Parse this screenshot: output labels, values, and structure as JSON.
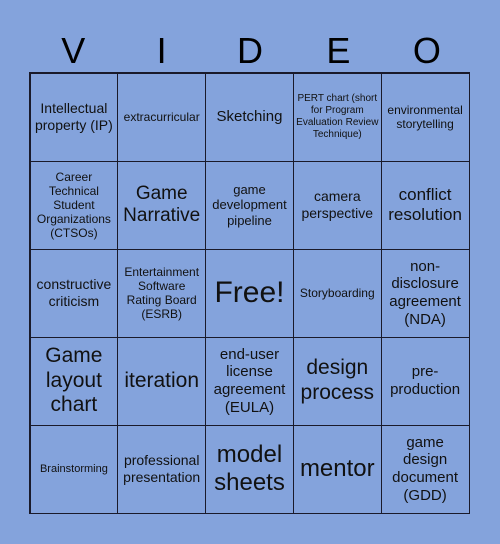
{
  "header": {
    "letters": [
      "V",
      "I",
      "D",
      "E",
      "O"
    ]
  },
  "cells": [
    [
      "Intellectual property (IP)",
      "extracurricular",
      "Sketching",
      "PERT chart (short for Program Evaluation Review Technique)",
      "environmental storytelling"
    ],
    [
      "Career Technical Student Organizations (CTSOs)",
      "Game Narrative",
      "game development pipeline",
      "camera perspective",
      "conflict resolution"
    ],
    [
      "constructive criticism",
      "Entertainment Software Rating Board (ESRB)",
      "Free!",
      "Storyboarding",
      "non-disclosure agreement (NDA)"
    ],
    [
      "Game layout chart",
      "iteration",
      "end-user license agreement (EULA)",
      "design process",
      "pre-production"
    ],
    [
      "Brainstorming",
      "professional presentation",
      "model sheets",
      "mentor",
      "game design document (GDD)"
    ]
  ]
}
